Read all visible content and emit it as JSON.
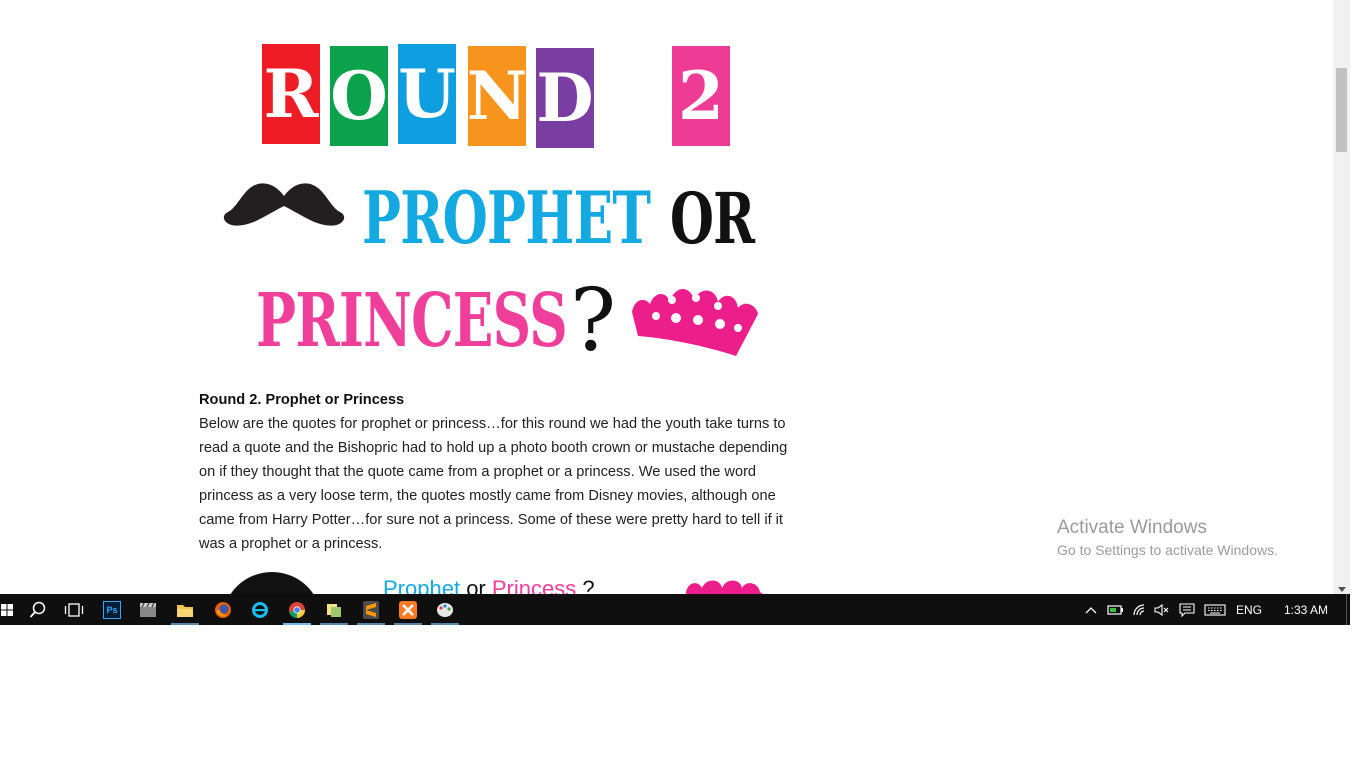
{
  "header_graphic": {
    "round_letters": [
      {
        "char": "R",
        "color": "#ee1c25"
      },
      {
        "char": "O",
        "color": "#0aa24b"
      },
      {
        "char": "U",
        "color": "#0f9fe0"
      },
      {
        "char": "N",
        "color": "#f7941d"
      },
      {
        "char": "D",
        "color": "#7a3da2"
      },
      {
        "char": "2",
        "color": "#ee3c96"
      }
    ],
    "prophet_word": "PROPHET",
    "or_word": "OR",
    "princess_word": "PRINCESS",
    "question_mark": "?"
  },
  "article": {
    "heading": "Round 2. Prophet or Princess",
    "body": "Below are the quotes for prophet or princess…for this round we had the youth take turns to read a quote and the Bishopric had to hold up a photo booth crown or mustache depending on if they thought that the quote came from a prophet or a princess. We used the word princess as a very loose term, the quotes mostly came from Disney movies, although one came from Harry Potter…for sure not a princess. Some of these were pretty hard to tell if it was a prophet or a princess."
  },
  "sub_graphic": {
    "prophet": "Prophet",
    "or": "or",
    "princess": "Princess",
    "question": "?",
    "prophet_color": "#14a9e0",
    "princess_color": "#ef3f9a"
  },
  "watermark": {
    "line1": "Activate Windows",
    "line2": "Go to Settings to activate Windows."
  },
  "taskbar": {
    "apps": [
      {
        "icon": "photoshop-icon",
        "label": "Ps"
      },
      {
        "icon": "clapperboard-icon"
      },
      {
        "icon": "file-explorer-icon"
      },
      {
        "icon": "firefox-icon"
      },
      {
        "icon": "internet-explorer-icon"
      },
      {
        "icon": "chrome-icon"
      },
      {
        "icon": "files-icon"
      },
      {
        "icon": "sublime-text-icon"
      },
      {
        "icon": "xampp-icon"
      },
      {
        "icon": "paint-icon"
      }
    ],
    "language": "ENG",
    "time": "1:33 AM"
  }
}
